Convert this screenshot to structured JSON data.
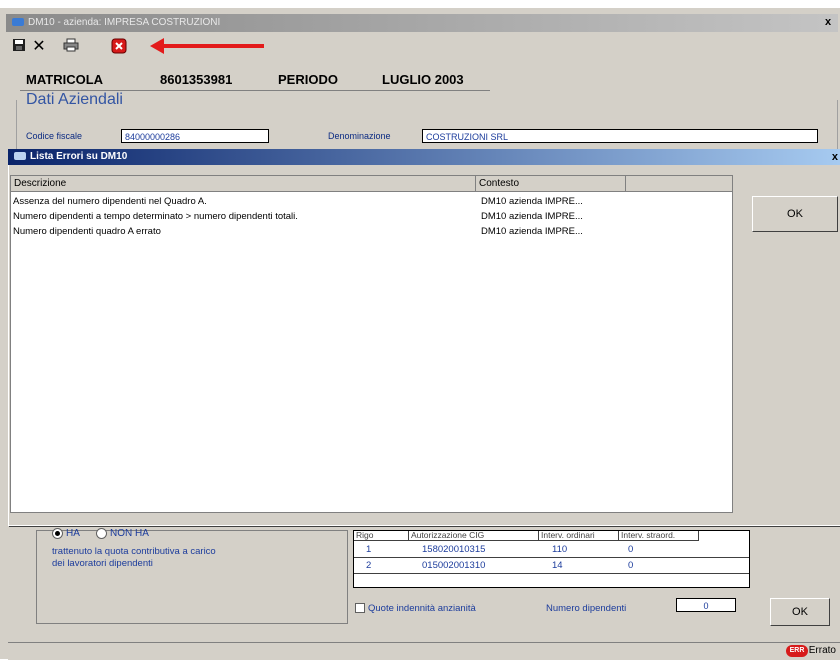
{
  "window": {
    "title": "DM10 - azienda: IMPRESA COSTRUZIONI",
    "close": "x"
  },
  "toolbar": {
    "save_icon": "floppy-icon",
    "cancel_icon": "x-icon",
    "print_icon": "printer-icon",
    "errors_icon": "error-icon"
  },
  "header": {
    "matricola_label": "MATRICOLA",
    "matricola_value": "8601353981",
    "periodo_label": "PERIODO",
    "periodo_value": "LUGLIO 2003"
  },
  "dati": {
    "group_label": "Dati Aziendali",
    "codice_fiscale_label": "Codice fiscale",
    "codice_fiscale_value": "84000000286",
    "denominazione_label": "Denominazione",
    "denominazione_value": "COSTRUZIONI SRL"
  },
  "dialog": {
    "title": "Lista Errori su DM10",
    "close": "x",
    "columns": [
      "Descrizione",
      "Contesto"
    ],
    "rows": [
      {
        "descrizione": "Assenza del numero dipendenti nel Quadro A.",
        "contesto": "DM10 azienda IMPRE..."
      },
      {
        "descrizione": "Numero dipendenti a tempo determinato > numero dipendenti totali.",
        "contesto": "DM10 azienda IMPRE..."
      },
      {
        "descrizione": "Numero dipendenti quadro A errato",
        "contesto": "DM10 azienda IMPRE..."
      }
    ],
    "ok_label": "OK"
  },
  "lower": {
    "radio_ha": "HA",
    "radio_non_ha": "NON HA",
    "radio_selected": "HA",
    "note_line1": "trattenuto la quota contributiva a carico",
    "note_line2": "dei lavoratori dipendenti",
    "grid_headers": [
      "Rigo",
      "Autorizzazione CIG",
      "Interv. ordinari",
      "Interv. straord."
    ],
    "grid_rows": [
      {
        "rigo": "1",
        "autorizzazione": "158020010315",
        "ordinari": "110",
        "straord": "0"
      },
      {
        "rigo": "2",
        "autorizzazione": "015002001310",
        "ordinari": "14",
        "straord": "0"
      }
    ],
    "quote_checkbox": "Quote indennità anzianità",
    "numero_label": "Numero dipendenti",
    "numero_value": "0",
    "ok_label": "OK"
  },
  "statusbar": {
    "badge": "ERR",
    "text": "Errato"
  }
}
